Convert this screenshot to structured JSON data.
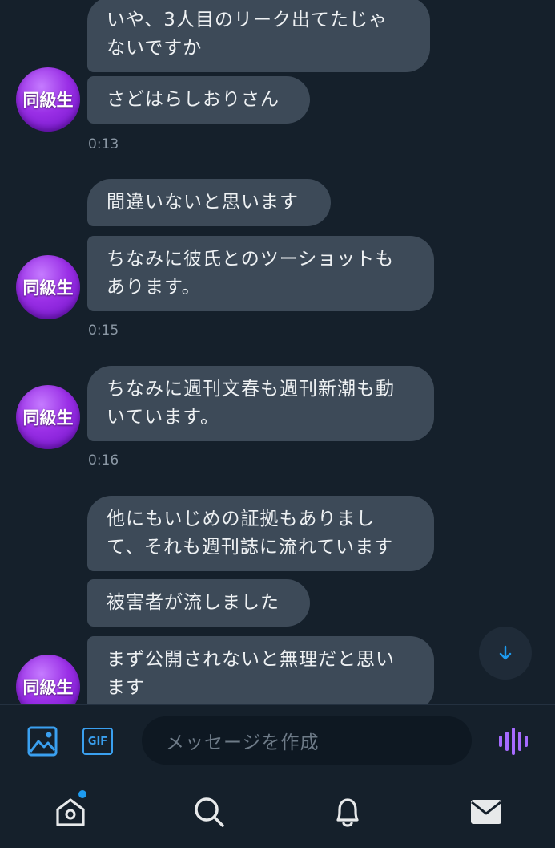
{
  "avatar_label": "同級生",
  "messages": [
    {
      "text": "いや、3人目のリーク出てたじゃ\nないですか"
    },
    {
      "text": "さどはらしおりさん"
    },
    {
      "time": "0:13"
    },
    {
      "text": "間違いないと思います"
    },
    {
      "text": "ちなみに彼氏とのツーショットも\nあります。"
    },
    {
      "time": "0:15"
    },
    {
      "text": "ちなみに週刊文春も週刊新潮も動\nいています。"
    },
    {
      "time": "0:16"
    },
    {
      "text": "他にもいじめの証拠もありまし\nて、それも週刊誌に流れています"
    },
    {
      "text": "被害者が流しました"
    },
    {
      "text": "まず公開されないと無理だと思い\nます"
    }
  ],
  "composer": {
    "placeholder": "メッセージを作成",
    "gif_label": "GIF"
  },
  "icons": {
    "image": "image-icon",
    "gif": "gif-icon",
    "voice": "voice-wave-icon",
    "scroll_down": "arrow-down-icon",
    "home": "home-icon",
    "search": "search-icon",
    "notifications": "bell-icon",
    "messages": "mail-icon"
  },
  "colors": {
    "background": "#15202b",
    "bubble": "#3d4a58",
    "accent": "#1d9bf0",
    "avatar": "#9a2fe6",
    "voice": "#a66bff"
  },
  "home_has_notification_dot": true
}
